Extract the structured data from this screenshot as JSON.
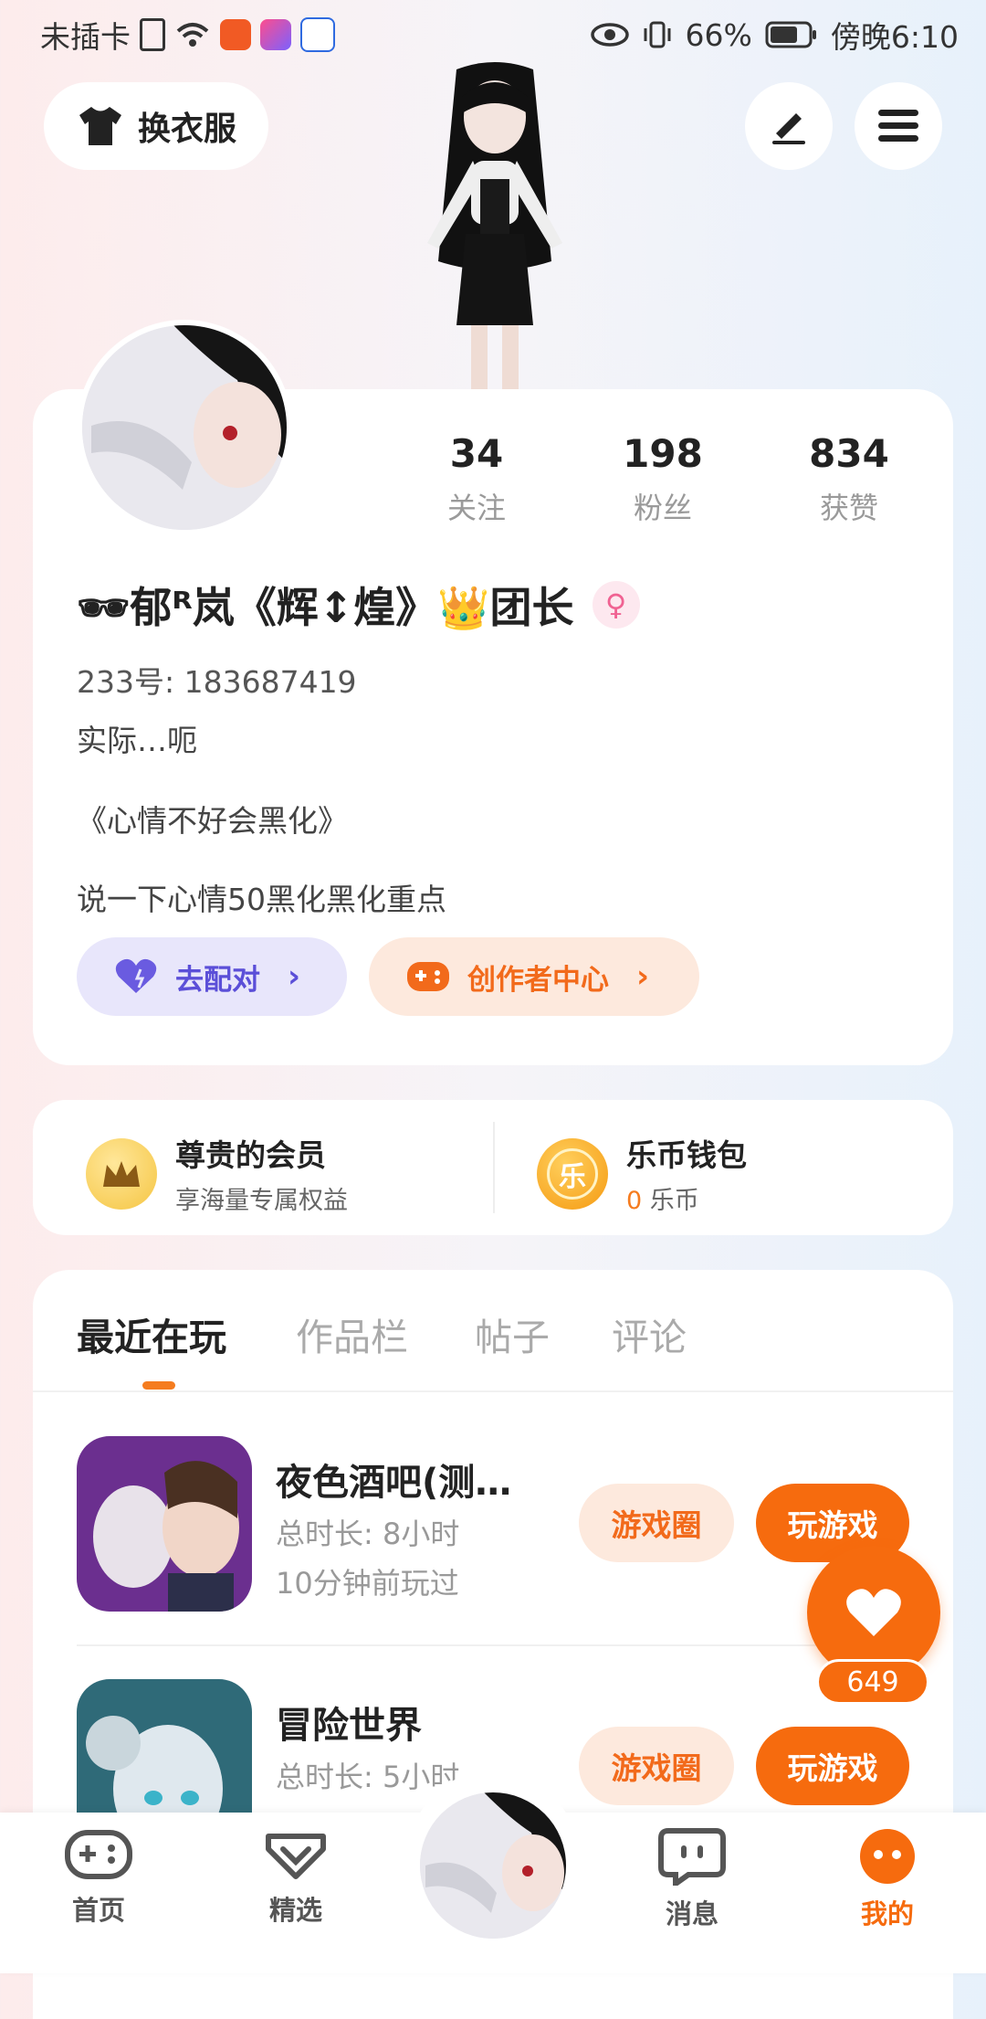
{
  "status_bar": {
    "carrier": "未插卡",
    "battery": "66%",
    "time": "傍晚6:10"
  },
  "header": {
    "dress_label": "换衣服",
    "edit_icon": "pen-icon",
    "menu_icon": "menu-icon"
  },
  "profile": {
    "stats": [
      {
        "value": "34",
        "label": "关注"
      },
      {
        "value": "198",
        "label": "粉丝"
      },
      {
        "value": "834",
        "label": "获赞"
      }
    ],
    "username": "🕶郁ᴿ岚《辉↕煌》👑团长",
    "id_line": "233号: 183687419",
    "bio_lines": [
      "实际…呃",
      "《心情不好会黑化》",
      "说一下心情50黑化黑化重点"
    ],
    "match_label": "去配对",
    "creator_label": "创作者中心"
  },
  "membership": {
    "member_title": "尊贵的会员",
    "member_sub": "享海量专属权益",
    "wallet_title": "乐币钱包",
    "wallet_value": "0",
    "wallet_unit": "乐币",
    "coin_char": "乐"
  },
  "tabs": [
    "最近在玩",
    "作品栏",
    "帖子",
    "评论"
  ],
  "games": [
    {
      "title": "夜色酒吧(测…",
      "duration": "总时长: 8小时",
      "last_played": "10分钟前玩过",
      "circle_label": "游戏圈",
      "play_label": "玩游戏"
    },
    {
      "title": "冒险世界",
      "duration": "总时长: 5小时",
      "last_played": "",
      "circle_label": "游戏圈",
      "play_label": "玩游戏"
    }
  ],
  "like_count": "649",
  "nav": {
    "items": [
      {
        "label": "首页",
        "icon": "gamepad-icon"
      },
      {
        "label": "精选",
        "icon": "heart-box-icon"
      },
      {
        "label": "消息",
        "icon": "chat-icon"
      },
      {
        "label": "我的",
        "icon": "face-icon"
      }
    ]
  },
  "colors": {
    "accent": "#f66b0e",
    "purple": "#5b4fd8"
  }
}
